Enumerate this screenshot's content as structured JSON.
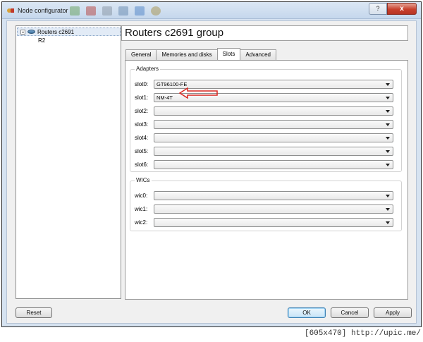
{
  "window": {
    "title": "Node configurator",
    "help_label": "?",
    "close_label": "x"
  },
  "tree": {
    "group_label": "Routers c2691",
    "child_label": "R2"
  },
  "panel": {
    "title": "Routers c2691 group",
    "tabs": [
      "General",
      "Memories and disks",
      "Slots",
      "Advanced"
    ],
    "active_tab": "Slots"
  },
  "adapters": {
    "title": "Adapters",
    "slots": [
      {
        "label": "slot0:",
        "value": "GT96100-FE"
      },
      {
        "label": "slot1:",
        "value": "NM-4T"
      },
      {
        "label": "slot2:",
        "value": ""
      },
      {
        "label": "slot3:",
        "value": ""
      },
      {
        "label": "slot4:",
        "value": ""
      },
      {
        "label": "slot5:",
        "value": ""
      },
      {
        "label": "slot6:",
        "value": ""
      }
    ]
  },
  "wics": {
    "title": "WICs",
    "slots": [
      {
        "label": "wic0:",
        "value": ""
      },
      {
        "label": "wic1:",
        "value": ""
      },
      {
        "label": "wic2:",
        "value": ""
      }
    ]
  },
  "buttons": {
    "reset": "Reset",
    "ok": "OK",
    "cancel": "Cancel",
    "apply": "Apply"
  },
  "annotation": {
    "arrow_color": "#d9251f"
  },
  "watermark": "[605x470] http://upic.me/"
}
